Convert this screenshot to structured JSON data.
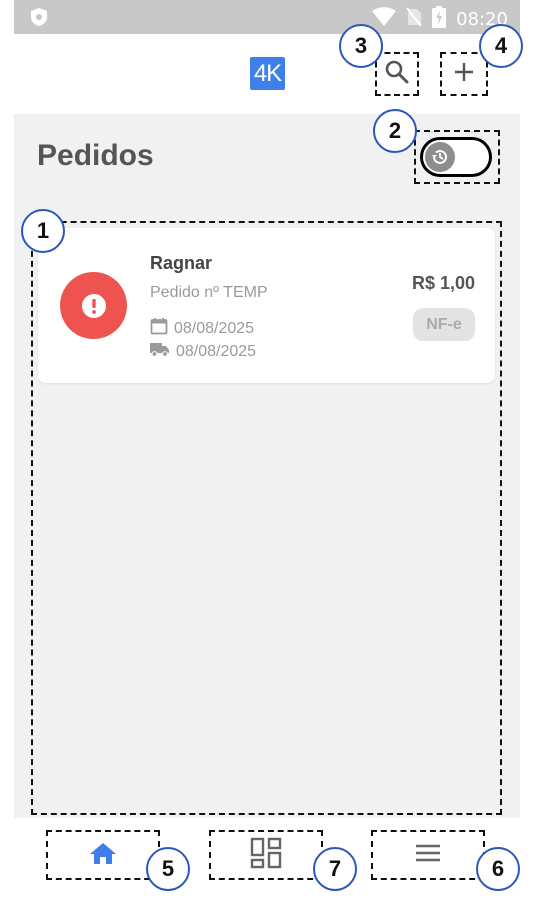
{
  "status_bar": {
    "time": "08:20"
  },
  "app_bar": {
    "logo_text": "4K"
  },
  "page": {
    "title": "Pedidos"
  },
  "orders": [
    {
      "customer": "Ragnar",
      "order_label": "Pedido nº TEMP",
      "order_date": "08/08/2025",
      "delivery_date": "08/08/2025",
      "total": "R$ 1,00",
      "badge": "NF-e"
    }
  ],
  "annotations": {
    "list": "1",
    "toggle": "2",
    "search": "3",
    "add": "4",
    "home": "5",
    "menu": "6",
    "dashboard": "7"
  },
  "colors": {
    "accent": "#3f7fea",
    "alert": "#ef5350",
    "background": "#f1f1f1"
  }
}
